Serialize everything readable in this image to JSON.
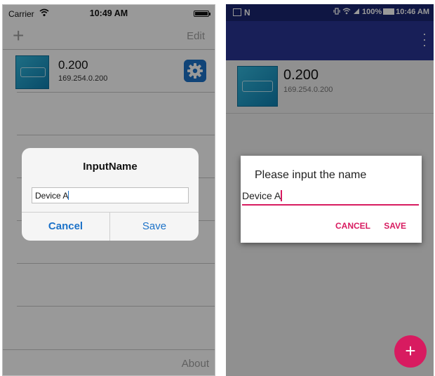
{
  "ios": {
    "status": {
      "carrier": "Carrier",
      "time": "10:49 AM"
    },
    "nav": {
      "add_symbol": "+",
      "edit_label": "Edit"
    },
    "device": {
      "name": "0.200",
      "ip": "169.254.0.200"
    },
    "footer": {
      "about_label": "About"
    },
    "dialog": {
      "title": "InputName",
      "input_value": "Device A",
      "cancel_label": "Cancel",
      "save_label": "Save"
    }
  },
  "android": {
    "status": {
      "left_text": "N",
      "right_text": "100%",
      "time": "10:46 AM"
    },
    "device": {
      "name": "0.200",
      "ip": "169.254.0.200"
    },
    "dialog": {
      "title": "Please input the name",
      "input_value": "Device A",
      "cancel_label": "CANCEL",
      "save_label": "SAVE"
    },
    "fab_symbol": "+"
  },
  "colors": {
    "ios_accent": "#1c72c8",
    "android_primary": "#283593",
    "android_accent": "#d81b60"
  }
}
